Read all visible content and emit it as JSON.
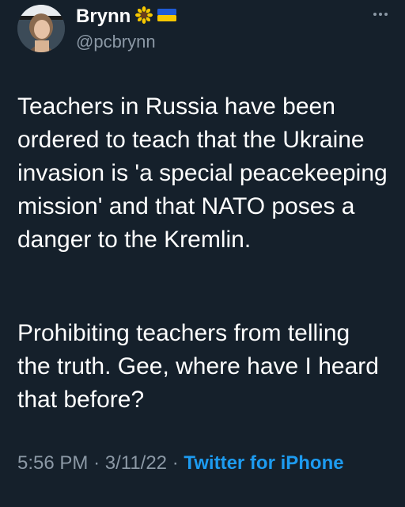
{
  "tweet": {
    "author": {
      "display_name": "Brynn",
      "badges": [
        "sunflower-icon",
        "ukraine-flag-icon"
      ],
      "handle": "@pcbrynn"
    },
    "more_icon": "ellipsis-icon",
    "paragraphs": [
      "Teachers in Russia have been ordered to teach that the Ukraine invasion is 'a special peacekeeping mission' and that NATO poses a danger to the Kremlin.",
      "Prohibiting teachers from telling the truth. Gee, where have I heard that before?"
    ],
    "time": "5:56 PM",
    "separator": "·",
    "date": "3/11/22",
    "source": "Twitter for iPhone"
  },
  "colors": {
    "background": "#15202b",
    "text": "#ffffff",
    "muted": "#8b98a5",
    "link": "#1d9bf0",
    "flag_blue": "#1f5bd6",
    "flag_yellow": "#f6c700"
  }
}
